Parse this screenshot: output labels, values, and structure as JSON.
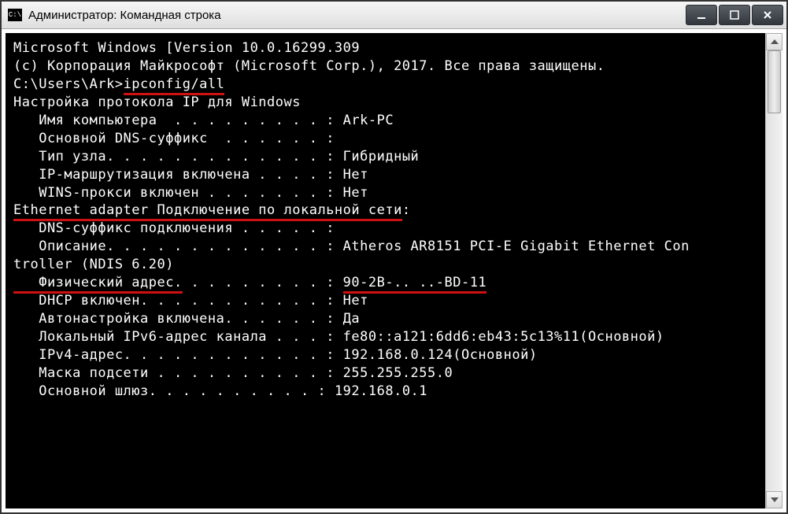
{
  "window": {
    "title": "Администратор: Командная строка"
  },
  "terminal": {
    "line1": "Microsoft Windows [Version 10.0.16299.309",
    "line2": "(c) Корпорация Майкрософт (Microsoft Corp.), 2017. Все права защищены.",
    "line3": "",
    "prompt_prefix": "C:\\Users\\Ark>",
    "command": "ipconfig/all",
    "line5": "",
    "section1": "Настройка протокола IP для Windows",
    "line7": "",
    "hostname_label": "   Имя компьютера  . . . . . . . . . :",
    "hostname_value": " Ark-PC",
    "dns_suffix": "   Основной DNS-суффикс  . . . . . . :",
    "node_type_label": "   Тип узла. . . . . . . . . . . . . :",
    "node_type_value": " Гибридный",
    "ip_routing_label": "   IP-маршрутизация включена . . . . :",
    "ip_routing_value": " Нет",
    "wins_proxy_label": "   WINS-прокси включен . . . . . . . :",
    "wins_proxy_value": " Нет",
    "line13": "",
    "adapter_header": "Ethernet adapter Подключение по локальной сети",
    "adapter_colon": ":",
    "line15": "",
    "conn_dns_suffix": "   DNS-суффикс подключения . . . . . :",
    "description_label": "   Описание. . . . . . . . . . . . . :",
    "description_value": " Atheros AR8151 PCI-E Gigabit Ethernet Con",
    "description_cont": "troller (NDIS 6.20)",
    "phys_addr_label": "   Физический адрес.",
    "phys_addr_dots": " . . . . . . . . : ",
    "phys_addr_value": "90-2B-.. ..-BD-11",
    "dhcp_label": "   DHCP включен. . . . . . . . . . . :",
    "dhcp_value": " Нет",
    "autoconf_label": "   Автонастройка включена. . . . . . :",
    "autoconf_value": " Да",
    "ipv6_label": "   Локальный IPv6-адрес канала . . . :",
    "ipv6_value": " fe80::a121:6dd6:eb43:5c13%11(Основной)",
    "ipv4_label": "   IPv4-адрес. . . . . . . . . . . . :",
    "ipv4_value": " 192.168.0.124(Основной)",
    "mask_label": "   Маска подсети . . . . . . . . . . :",
    "mask_value": " 255.255.255.0",
    "gateway_label": "   Основной шлюз. . . . . . . . . . :",
    "gateway_value": " 192.168.0.1"
  }
}
